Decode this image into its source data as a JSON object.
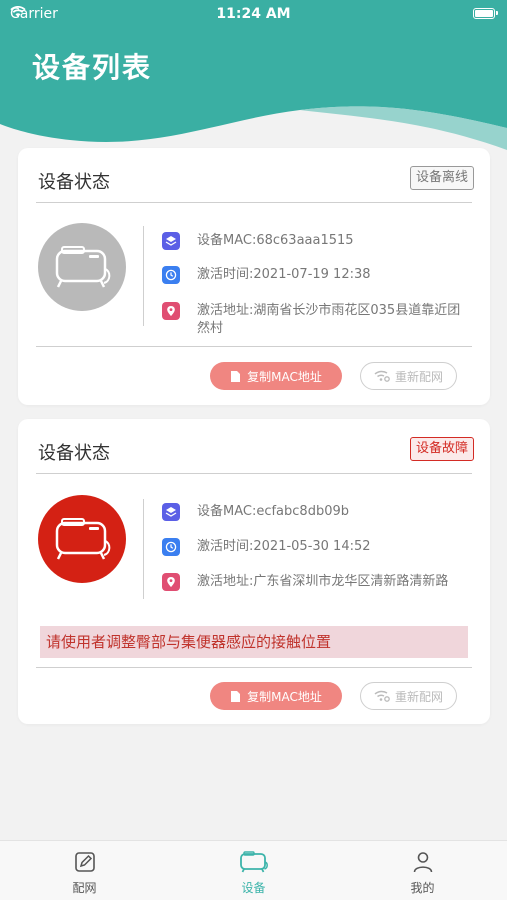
{
  "status_bar": {
    "carrier": "Carrier",
    "time": "11:24 AM"
  },
  "header": {
    "title": "设备列表",
    "color": "#3aafa3"
  },
  "devices": [
    {
      "title": "设备状态",
      "status": "设备离线",
      "state": "offline",
      "mac": "设备MAC:68c63aaa1515",
      "activation_time": "激活时间:2021-07-19 12:38",
      "address": "激活地址:湖南省长沙市雨花区035县道靠近团然村",
      "warning": "",
      "copy_button": "复制MAC地址",
      "reconfig_button": "重新配网"
    },
    {
      "title": "设备状态",
      "status": "设备故障",
      "state": "fault",
      "mac": "设备MAC:ecfabc8db09b",
      "activation_time": "激活时间:2021-05-30 14:52",
      "address": "激活地址:广东省深圳市龙华区清新路清新路",
      "warning": "请使用者调整臀部与集便器感应的接触位置",
      "copy_button": "复制MAC地址",
      "reconfig_button": "重新配网"
    }
  ],
  "tabbar": {
    "items": [
      {
        "label": "配网",
        "icon": "edit-icon",
        "active": false
      },
      {
        "label": "设备",
        "icon": "device-icon",
        "active": true
      },
      {
        "label": "我的",
        "icon": "user-icon",
        "active": false
      }
    ],
    "active_color": "#3cb4aa"
  }
}
